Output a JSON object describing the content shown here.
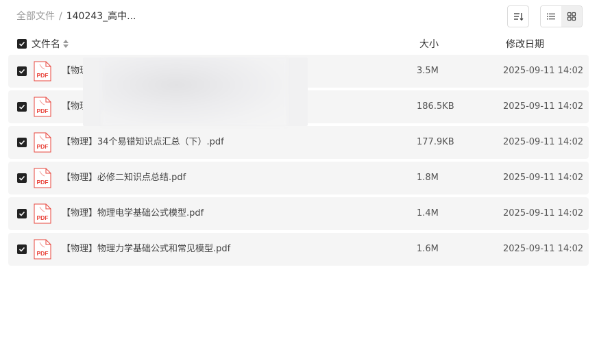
{
  "breadcrumb": {
    "root": "全部文件",
    "separator": "/",
    "current": "140243_高中..."
  },
  "toolbar": {
    "sort_icon": "sort-lines-icon",
    "list_view_icon": "list-view-icon",
    "grid_view_icon": "grid-view-icon",
    "active_view": "list"
  },
  "columns": {
    "name": "文件名",
    "size": "大小",
    "date": "修改日期"
  },
  "files": [
    {
      "name": "【物理",
      "size": "3.5M",
      "date": "2025-09-11 14:02",
      "icon_label": "PDF",
      "checked": true
    },
    {
      "name": "【物理",
      "size": "186.5KB",
      "date": "2025-09-11 14:02",
      "icon_label": "PDF",
      "checked": true
    },
    {
      "name": "【物理】34个易错知识点汇总（下）.pdf",
      "size": "177.9KB",
      "date": "2025-09-11 14:02",
      "icon_label": "PDF",
      "checked": true
    },
    {
      "name": "【物理】必修二知识点总结.pdf",
      "size": "1.8M",
      "date": "2025-09-11 14:02",
      "icon_label": "PDF",
      "checked": true
    },
    {
      "name": "【物理】物理电学基础公式模型.pdf",
      "size": "1.4M",
      "date": "2025-09-11 14:02",
      "icon_label": "PDF",
      "checked": true
    },
    {
      "name": "【物理】物理力学基础公式和常见模型.pdf",
      "size": "1.6M",
      "date": "2025-09-11 14:02",
      "icon_label": "PDF",
      "checked": true
    }
  ],
  "colors": {
    "row_bg": "#f5f5f5",
    "pdf_red": "#e8453c",
    "checkbox": "#222222"
  }
}
